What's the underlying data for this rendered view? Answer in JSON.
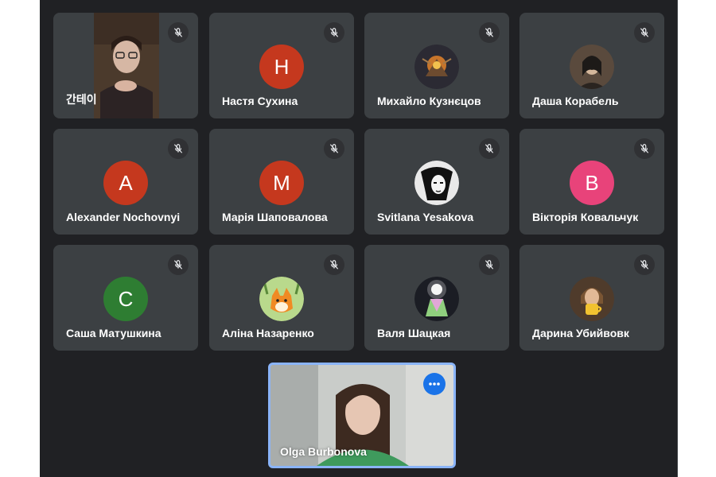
{
  "colors": {
    "background": "#202124",
    "tile": "#3c4043",
    "active_border": "#8ab4f8",
    "more_button": "#1a73e8"
  },
  "participants": [
    {
      "name": "간테이",
      "avatar_type": "video",
      "muted": true
    },
    {
      "name": "Настя Сухина",
      "avatar_type": "initial",
      "initial": "H",
      "avatar_color": "#c5381e",
      "muted": true
    },
    {
      "name": "Михайло Кузнєцов",
      "avatar_type": "photo",
      "photo": "fantasy-art-photo",
      "muted": true
    },
    {
      "name": "Даша Корабель",
      "avatar_type": "photo",
      "photo": "dark-portrait-photo",
      "muted": true
    },
    {
      "name": "Alexander Nochovnyi",
      "avatar_type": "initial",
      "initial": "A",
      "avatar_color": "#c5381e",
      "muted": true
    },
    {
      "name": "Марія Шаповалова",
      "avatar_type": "initial",
      "initial": "M",
      "avatar_color": "#c5381e",
      "muted": true
    },
    {
      "name": "Svitlana Yesakova",
      "avatar_type": "photo",
      "photo": "monochrome-portrait-photo",
      "muted": true
    },
    {
      "name": "Вікторія Ковальчук",
      "avatar_type": "initial",
      "initial": "B",
      "avatar_color": "#e8437a",
      "muted": true
    },
    {
      "name": "Саша Матушкина",
      "avatar_type": "initial",
      "initial": "C",
      "avatar_color": "#2e7d32",
      "muted": true
    },
    {
      "name": "Аліна Назаренко",
      "avatar_type": "photo",
      "photo": "cartoon-fox-photo",
      "muted": true
    },
    {
      "name": "Валя Шацкая",
      "avatar_type": "photo",
      "photo": "glowing-figure-photo",
      "muted": true
    },
    {
      "name": "Дарина Убийвовк",
      "avatar_type": "photo",
      "photo": "person-with-mug-photo",
      "muted": true
    }
  ],
  "self": {
    "name": "Olga Burbonova",
    "icon": "more-options-icon"
  },
  "icons": {
    "muted": "mic-off-icon"
  }
}
